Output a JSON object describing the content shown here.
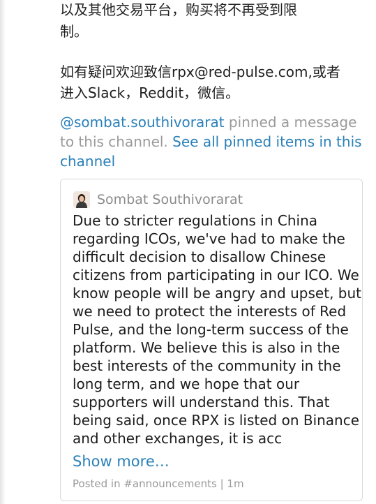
{
  "message": {
    "lines": [
      "以及其他交易平台，购买将不再受到限",
      "制。",
      "如有疑问欢迎致信rpx@red-pulse.com,或者",
      "进入Slack，Reddit，微信。"
    ]
  },
  "pin_notice": {
    "user": "@sombat.southivorarat",
    "text_line1": " pinned a message",
    "text_line2": "to this channel. ",
    "link_line2": "See all pinned items in this",
    "link_line3": "channel"
  },
  "pinned_card": {
    "author": "Sombat Southivorarat",
    "avatar_icon": "user-avatar-icon",
    "body_lines": [
      "Due to stricter regulations in China",
      "regarding ICOs, we've had to make the",
      "difficult decision to disallow Chinese",
      "citizens from participating in our ICO. We",
      "know people will be angry and upset, but",
      "we need to protect the interests of Red",
      "Pulse, and the long-term success of the",
      "platform. We believe this is also in the",
      "best interests of the community in the",
      "long term, and we hope that our",
      "supporters will understand this. That",
      "being said, once RPX is listed on Binance",
      "and other exchanges, it is acc"
    ],
    "show_more": "Show more…",
    "meta": "Posted in #announcements | 1m"
  },
  "colors": {
    "link": "#2a80b9",
    "muted": "#9a9a9a",
    "text": "#1d1c1d",
    "border": "#d9d9d9"
  }
}
